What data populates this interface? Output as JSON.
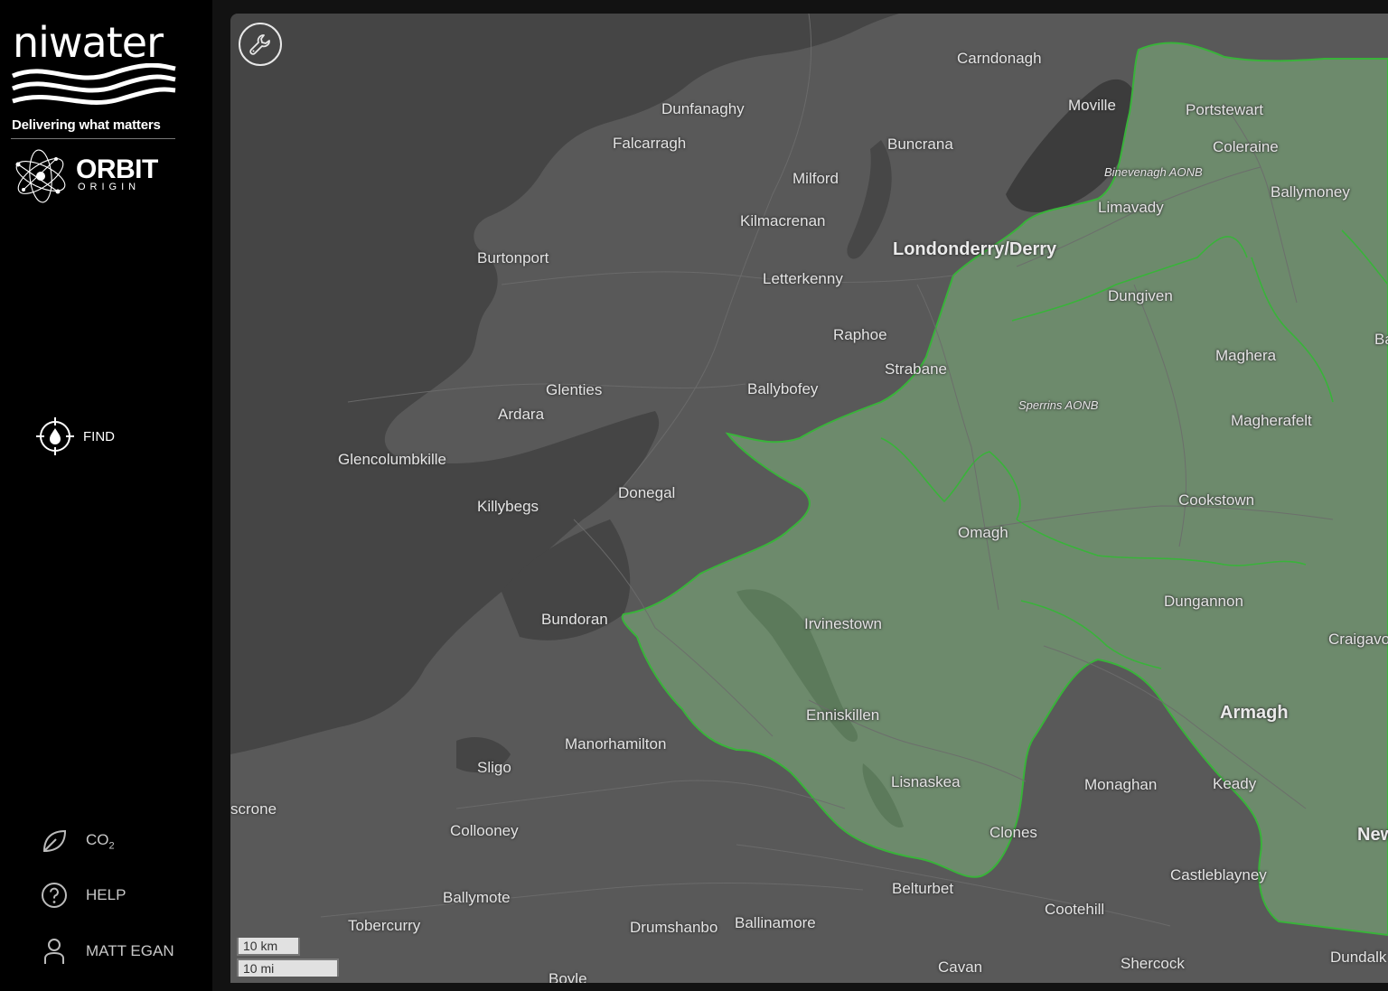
{
  "brand": {
    "name": "niwater",
    "tagline": "Delivering what matters",
    "product_name": "ORBIT",
    "product_sub": "ORIGIN"
  },
  "sidebar": {
    "find_label": "FIND",
    "co2_label": "CO",
    "co2_sub": "2",
    "help_label": "HELP",
    "user_label": "MATT EGAN"
  },
  "map": {
    "labels": [
      "Carndonagh",
      "Dunfanaghy",
      "Falcarragh",
      "Moville",
      "Portstewart",
      "Buncrana",
      "Coleraine",
      "Binevenagh AONB",
      "Ballymoney",
      "Milford",
      "Limavady",
      "Kilmacrenan",
      "Londonderry/Derry",
      "Burtonport",
      "Letterkenny",
      "Dungiven",
      "Raphoe",
      "Maghera",
      "Strabane",
      "Glenties",
      "Ballybofey",
      "Sperrins AONB",
      "Ardara",
      "Magherafelt",
      "Glencolumbkille",
      "Donegal",
      "Killybegs",
      "Cookstown",
      "Omagh",
      "Dungannon",
      "Bundoran",
      "Irvinestown",
      "Craigavo",
      "Enniskillen",
      "Armagh",
      "Manorhamilton",
      "Sligo",
      "Lisnaskea",
      "Monaghan",
      "Keady",
      "scrone",
      "Collooney",
      "Clones",
      "New",
      "Castleblayney",
      "Belturbet",
      "Ballymote",
      "Cootehill",
      "Tobercurry",
      "Drumshanbo",
      "Ballinamore",
      "Cavan",
      "Shercock",
      "Dundalk",
      "Boyle",
      "Ba"
    ],
    "scale_km": "10 km",
    "scale_mi": "10 mi"
  },
  "colors": {
    "land": "#595959",
    "sea": "#454545",
    "ni_region": "#6d8a6c",
    "ni_border": "#39b33a",
    "sidebar": "#000000"
  },
  "icons": {
    "find": "crosshair-drop-icon",
    "co2": "leaf-icon",
    "help": "question-circle-icon",
    "user": "user-icon",
    "tools": "wrench-icon"
  }
}
